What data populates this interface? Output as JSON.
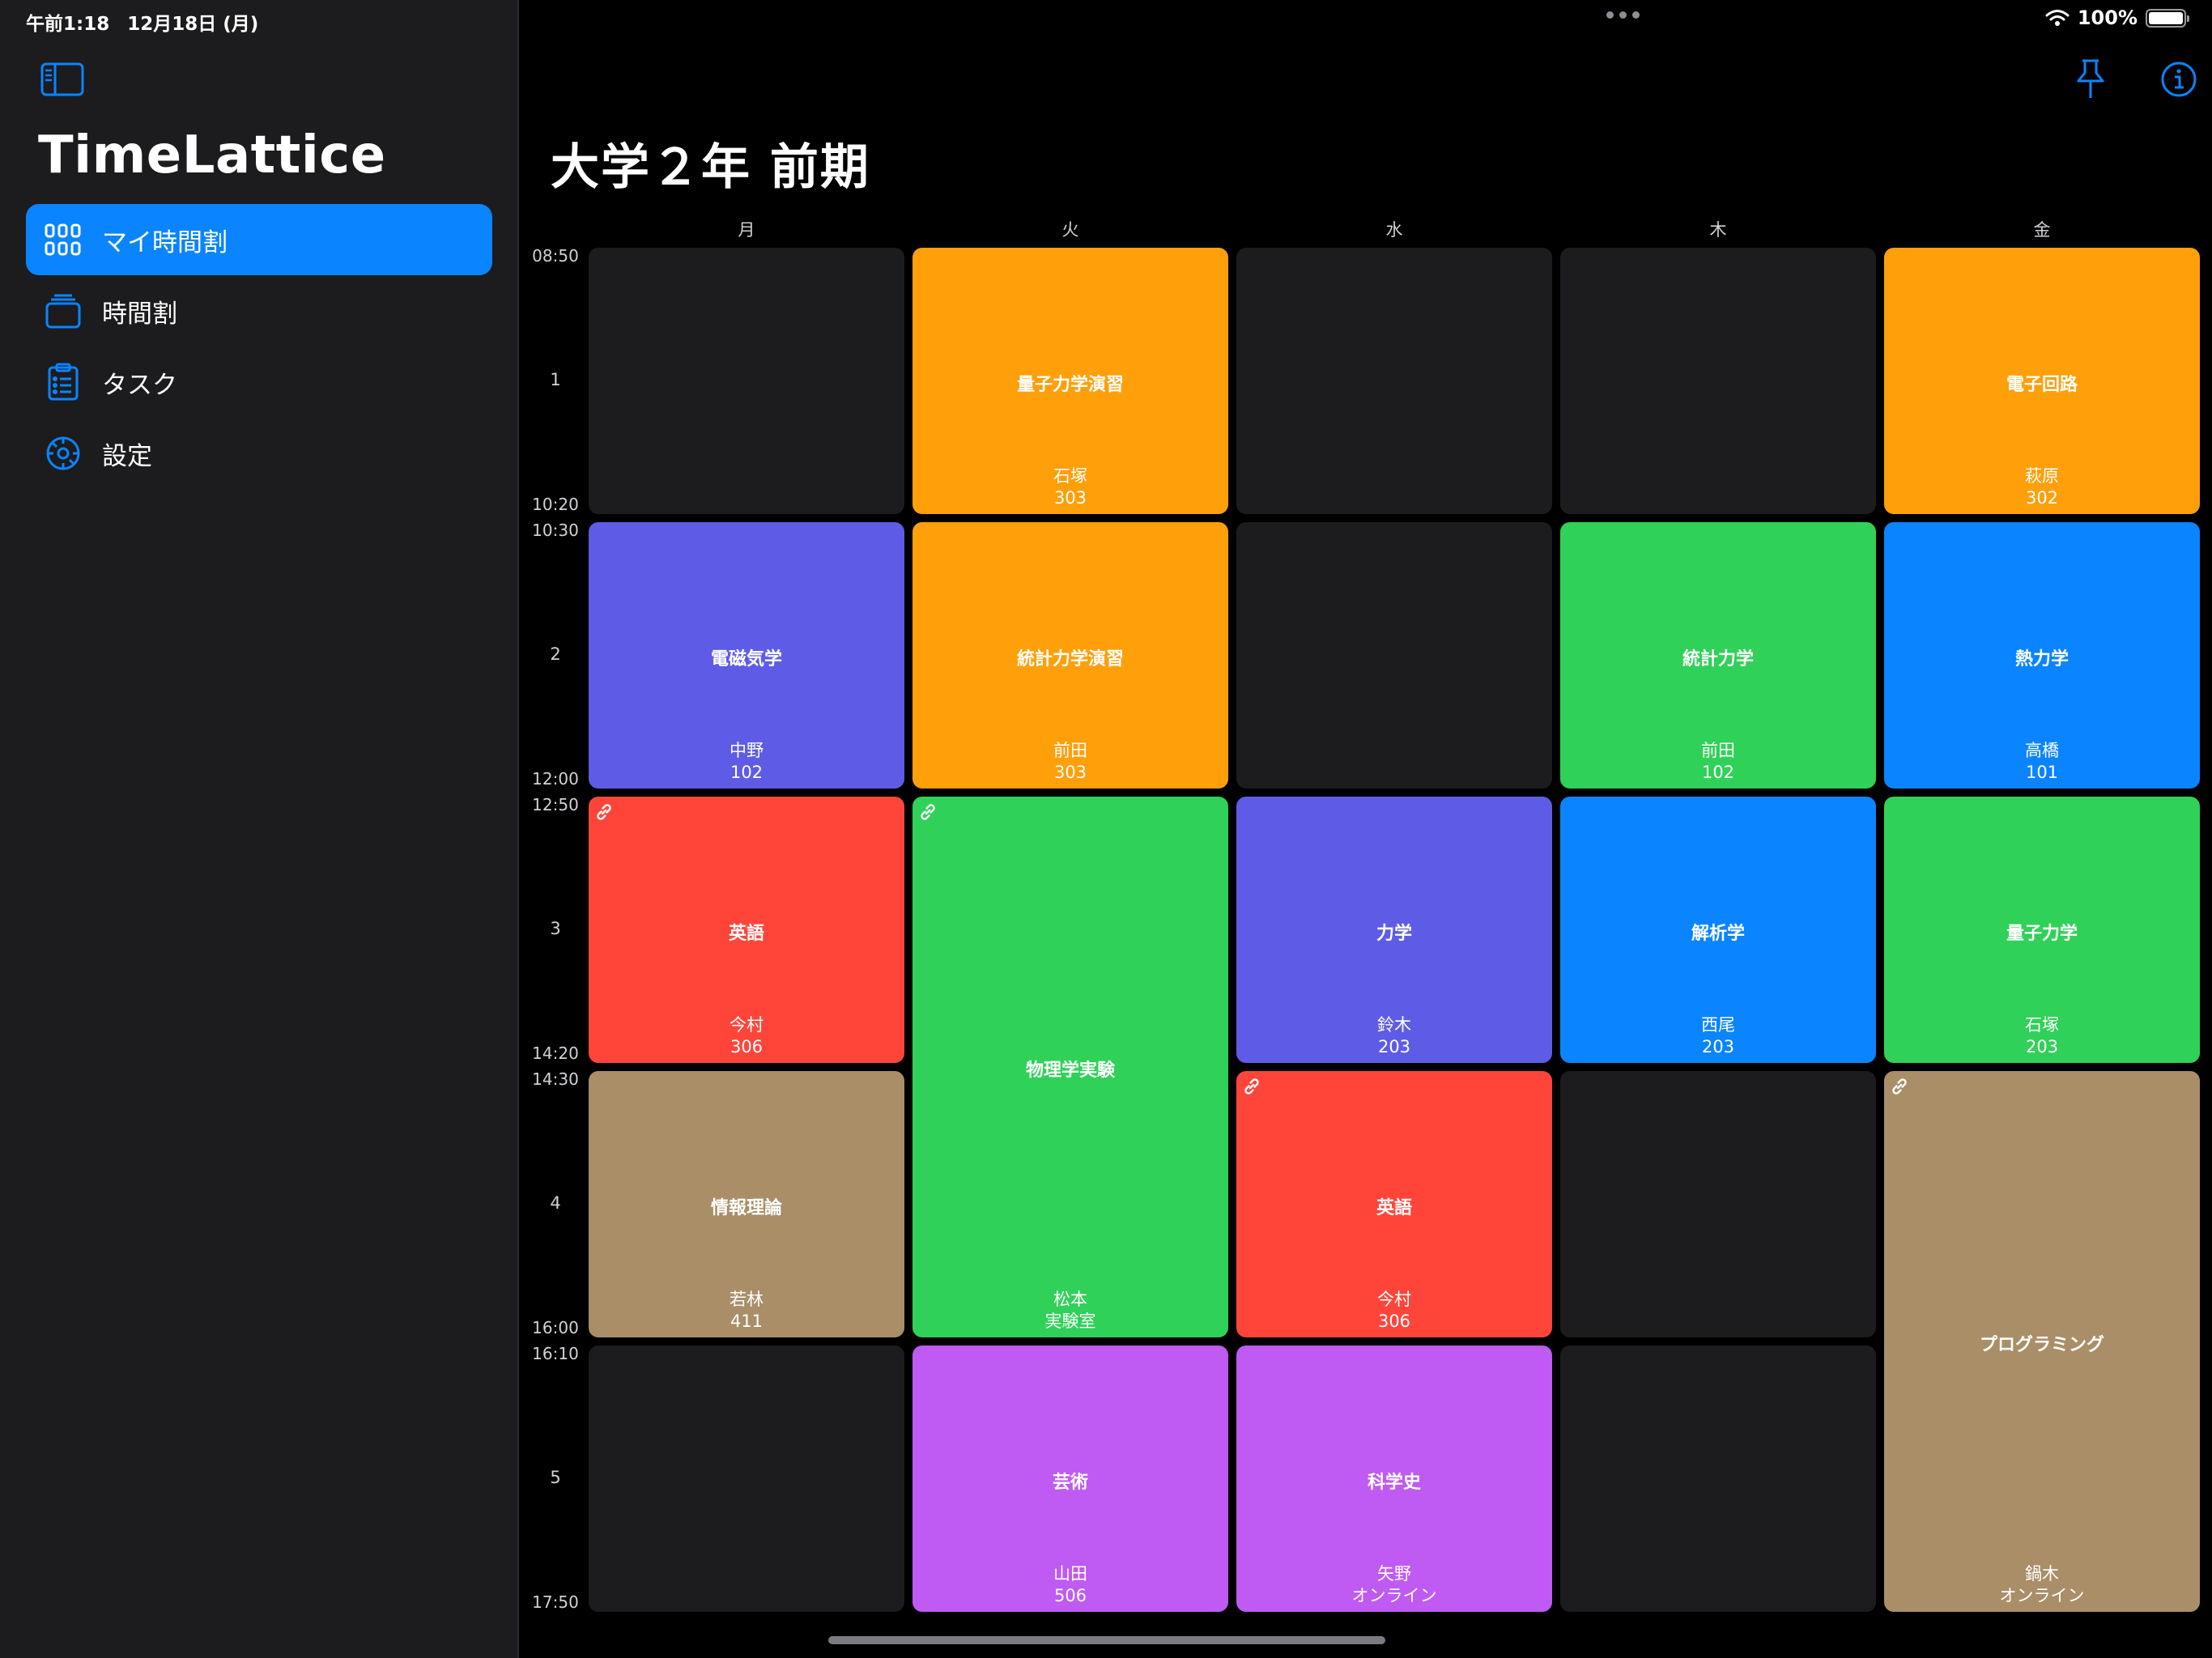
{
  "status": {
    "time": "午前1:18",
    "date": "12月18日 (月)",
    "battery": "100%"
  },
  "sidebar": {
    "app_title": "TimeLattice",
    "items": [
      {
        "label": "マイ時間割",
        "icon": "grid-icon",
        "active": true
      },
      {
        "label": "時間割",
        "icon": "stack-icon",
        "active": false
      },
      {
        "label": "タスク",
        "icon": "clipboard-icon",
        "active": false
      },
      {
        "label": "設定",
        "icon": "gear-icon",
        "active": false
      }
    ]
  },
  "main": {
    "title": "大学２年 前期",
    "days": [
      "月",
      "火",
      "水",
      "木",
      "金"
    ],
    "periods": [
      {
        "num": "1",
        "start": "08:50",
        "end": "10:20"
      },
      {
        "num": "2",
        "start": "10:30",
        "end": "12:00"
      },
      {
        "num": "3",
        "start": "12:50",
        "end": "14:20"
      },
      {
        "num": "4",
        "start": "14:30",
        "end": "16:00"
      },
      {
        "num": "5",
        "start": "16:10",
        "end": "17:50"
      }
    ],
    "courses": [
      {
        "name": "量子力学演習",
        "teacher": "石塚",
        "room": "303",
        "color": "#ff9f0a",
        "day": 1,
        "period": 0,
        "span": 1,
        "link": false
      },
      {
        "name": "電子回路",
        "teacher": "萩原",
        "room": "302",
        "color": "#ff9f0a",
        "day": 4,
        "period": 0,
        "span": 1,
        "link": false
      },
      {
        "name": "電磁気学",
        "teacher": "中野",
        "room": "102",
        "color": "#5e5ce6",
        "day": 0,
        "period": 1,
        "span": 1,
        "link": false
      },
      {
        "name": "統計力学演習",
        "teacher": "前田",
        "room": "303",
        "color": "#ff9f0a",
        "day": 1,
        "period": 1,
        "span": 1,
        "link": false
      },
      {
        "name": "統計力学",
        "teacher": "前田",
        "room": "102",
        "color": "#30d158",
        "day": 3,
        "period": 1,
        "span": 1,
        "link": false
      },
      {
        "name": "熱力学",
        "teacher": "高橋",
        "room": "101",
        "color": "#0a84ff",
        "day": 4,
        "period": 1,
        "span": 1,
        "link": false
      },
      {
        "name": "英語",
        "teacher": "今村",
        "room": "306",
        "color": "#ff453a",
        "day": 0,
        "period": 2,
        "span": 1,
        "link": true
      },
      {
        "name": "物理学実験",
        "teacher": "松本",
        "room": "実験室",
        "color": "#30d158",
        "day": 1,
        "period": 2,
        "span": 2,
        "link": true
      },
      {
        "name": "力学",
        "teacher": "鈴木",
        "room": "203",
        "color": "#5e5ce6",
        "day": 2,
        "period": 2,
        "span": 1,
        "link": false
      },
      {
        "name": "解析学",
        "teacher": "西尾",
        "room": "203",
        "color": "#0a84ff",
        "day": 3,
        "period": 2,
        "span": 1,
        "link": false
      },
      {
        "name": "量子力学",
        "teacher": "石塚",
        "room": "203",
        "color": "#30d158",
        "day": 4,
        "period": 2,
        "span": 1,
        "link": false
      },
      {
        "name": "情報理論",
        "teacher": "若林",
        "room": "411",
        "color": "#a98e68",
        "day": 0,
        "period": 3,
        "span": 1,
        "link": false
      },
      {
        "name": "英語",
        "teacher": "今村",
        "room": "306",
        "color": "#ff453a",
        "day": 2,
        "period": 3,
        "span": 1,
        "link": true
      },
      {
        "name": "プログラミング",
        "teacher": "鍋木",
        "room": "オンライン",
        "color": "#a98e68",
        "day": 4,
        "period": 3,
        "span": 2,
        "link": true
      },
      {
        "name": "芸術",
        "teacher": "山田",
        "room": "506",
        "color": "#bf5af2",
        "day": 1,
        "period": 4,
        "span": 1,
        "link": false
      },
      {
        "name": "科学史",
        "teacher": "矢野",
        "room": "オンライン",
        "color": "#bf5af2",
        "day": 2,
        "period": 4,
        "span": 1,
        "link": false
      }
    ]
  },
  "colors": {
    "accent": "#0a84ff",
    "empty_cell": "#1c1c1e",
    "sidebar_bg": "#1c1c1e"
  }
}
